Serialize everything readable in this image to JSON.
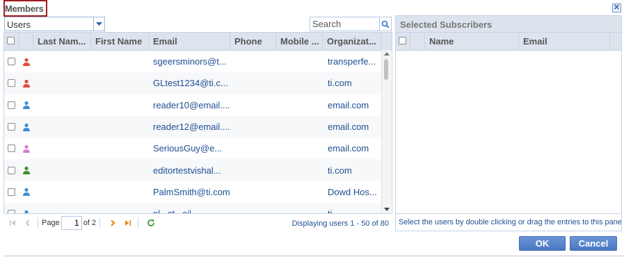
{
  "dialog": {
    "title": "Members"
  },
  "left": {
    "type_select": {
      "value": "Users"
    },
    "search": {
      "placeholder": "Search",
      "value": ""
    },
    "columns": [
      "Last Nam...",
      "First Name",
      "Email",
      "Phone",
      "Mobile ...",
      "Organizat..."
    ],
    "rows": [
      {
        "icon": "user-red-icon",
        "icon_color": "#e04b3a",
        "email": "sgeersminors@t...",
        "org": "transperfe..."
      },
      {
        "icon": "user-red-icon",
        "icon_color": "#e04b3a",
        "email": "GLtest1234@ti.c...",
        "org": "ti.com"
      },
      {
        "icon": "user-blue-icon",
        "icon_color": "#3f8fd2",
        "email": "reader10@email....",
        "org": "email.com"
      },
      {
        "icon": "user-blue-icon",
        "icon_color": "#3f8fd2",
        "email": "reader12@email....",
        "org": "email.com"
      },
      {
        "icon": "user-pink-icon",
        "icon_color": "#d67fd6",
        "email": "SeriousGuy@e...",
        "org": "email.com"
      },
      {
        "icon": "user-green-icon",
        "icon_color": "#3e8e2e",
        "email": "editortestvishal...",
        "org": "ti.com"
      },
      {
        "icon": "user-blue-icon",
        "icon_color": "#3f8fd2",
        "email": "PalmSmith@ti.com",
        "org": "Dowd Hos..."
      },
      {
        "icon": "user-blue-icon",
        "icon_color": "#3f8fd2",
        "email": "pl...st...ail...",
        "org": "ti..."
      }
    ],
    "pager": {
      "page_label": "Page",
      "page_value": "1",
      "of_label": "of 2",
      "status": "Displaying users 1 - 50 of 80"
    }
  },
  "right": {
    "title": "Selected Subscribers",
    "columns": [
      "Name",
      "Email"
    ],
    "hint": "Select the users by double clicking or drag the entries to this pane."
  },
  "buttons": {
    "ok": "OK",
    "cancel": "Cancel"
  },
  "colors": {
    "accent": "#4a78c2",
    "title_border": "#a01c1c",
    "link": "#1d4f91",
    "header_bg": "#dde4ee"
  }
}
